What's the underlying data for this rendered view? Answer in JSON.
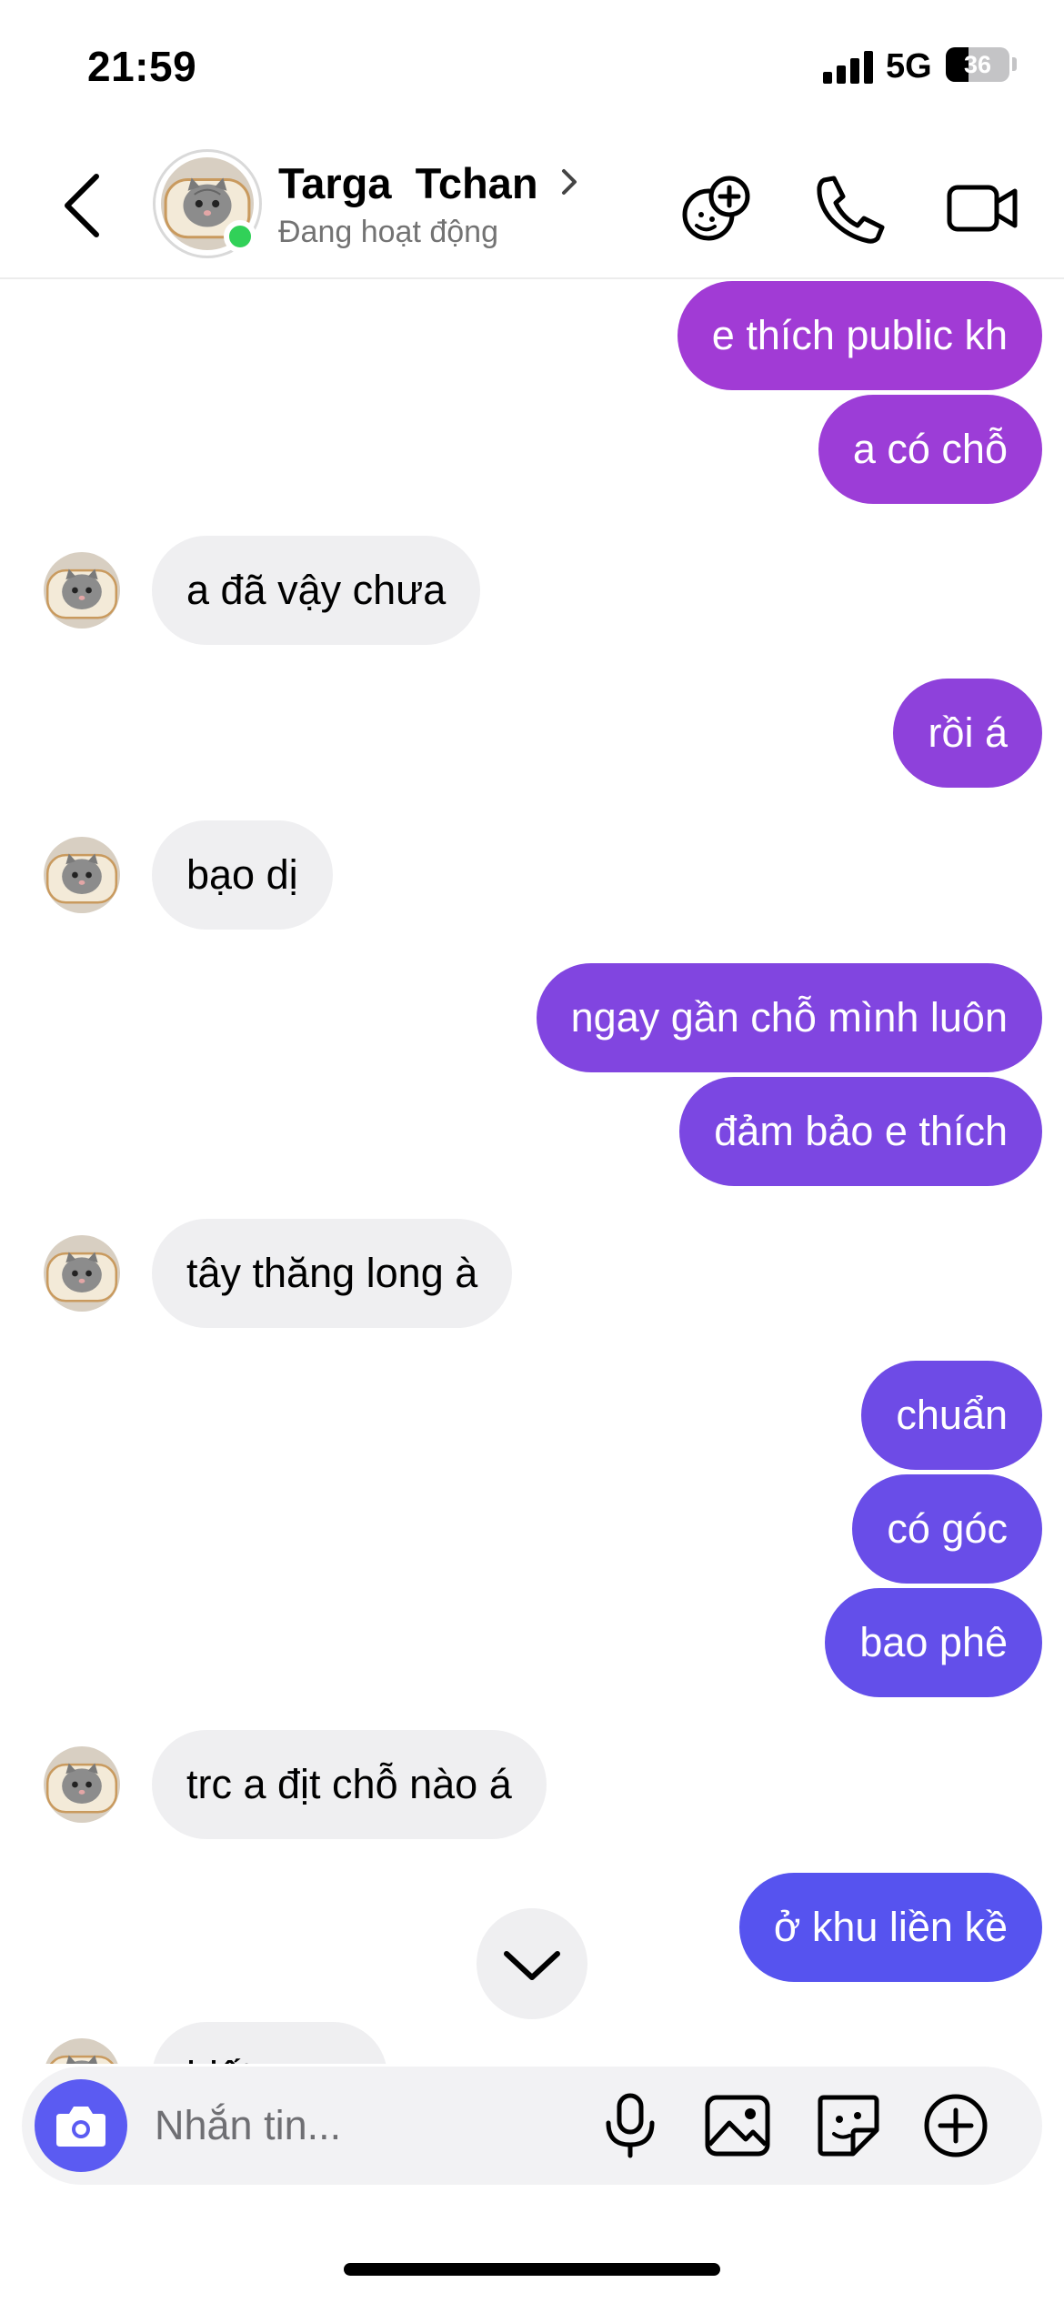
{
  "status_bar": {
    "time": "21:59",
    "network": "5G",
    "battery_level": 36,
    "battery_text": "36"
  },
  "header": {
    "contact_name": "Targa  Tchan",
    "presence": "Đang hoạt động",
    "icons": [
      "back-chevron-icon",
      "effects-icon",
      "phone-icon",
      "video-camera-icon"
    ]
  },
  "colors": {
    "gradient_top": "#a43ad4",
    "gradient_bottom": "#4f55f1",
    "incoming_bubble": "#efeff1",
    "online_dot": "#31d158",
    "camera_button": "#5b5bf2"
  },
  "messages": [
    {
      "direction": "outgoing",
      "text": "e thích public kh"
    },
    {
      "direction": "outgoing",
      "text": "a có chỗ"
    },
    {
      "direction": "incoming",
      "text": "a đã vậy chưa"
    },
    {
      "direction": "outgoing",
      "text": "rồi á"
    },
    {
      "direction": "incoming",
      "text": "bạo dị"
    },
    {
      "direction": "outgoing",
      "text": "ngay gần chỗ mình luôn"
    },
    {
      "direction": "outgoing",
      "text": "đảm bảo e thích"
    },
    {
      "direction": "incoming",
      "text": "tây thăng long à"
    },
    {
      "direction": "outgoing",
      "text": "chuẩn"
    },
    {
      "direction": "outgoing",
      "text": "có góc"
    },
    {
      "direction": "outgoing",
      "text": "bao phê"
    },
    {
      "direction": "incoming",
      "text": "trc a địt chỗ nào á"
    },
    {
      "direction": "outgoing",
      "text": "ở khu liền kề"
    },
    {
      "direction": "incoming",
      "text": "biết ngay"
    }
  ],
  "composer": {
    "placeholder": "Nhắn tin...",
    "icons": [
      "camera-icon",
      "microphone-icon",
      "gallery-icon",
      "sticker-icon",
      "add-icon"
    ]
  }
}
